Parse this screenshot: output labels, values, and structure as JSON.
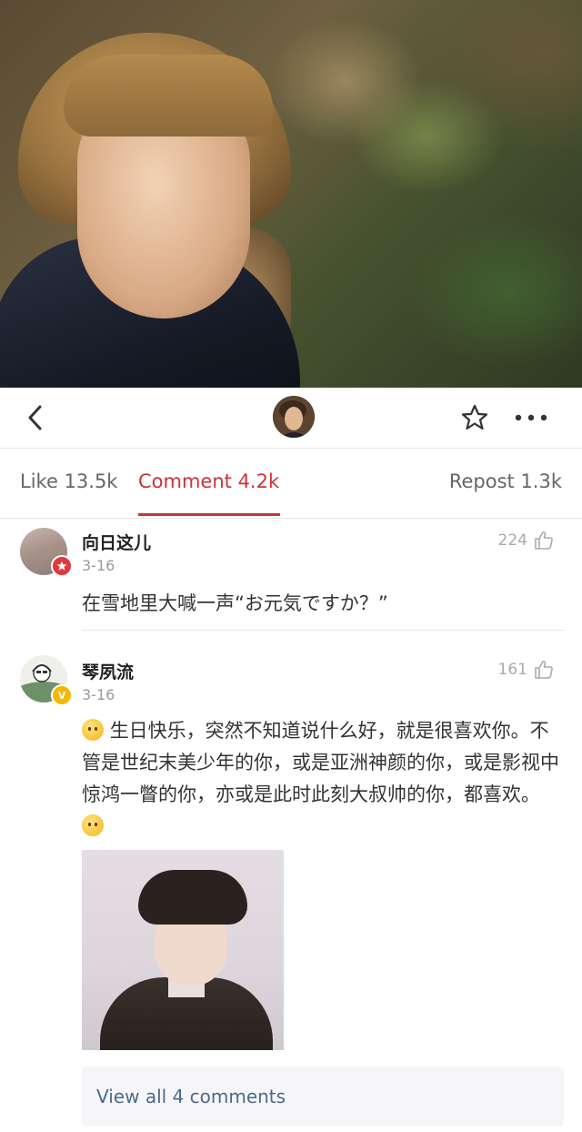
{
  "navbar": {
    "back_icon": "chevron-left-icon",
    "star_icon": "star-outline-icon",
    "more_icon": "more-dots-icon"
  },
  "tabs": {
    "like": "Like 13.5k",
    "comment": "Comment 4.2k",
    "repost": "Repost 1.3k",
    "active": "comment",
    "accent_color": "#c8343a"
  },
  "comments": [
    {
      "username": "向日这儿",
      "date": "3-16",
      "likes": "224",
      "badge": "red-star-badge",
      "text": "在雪地里大喊一声“お元気ですか？”"
    },
    {
      "username": "琴夙流",
      "date": "3-16",
      "likes": "161",
      "badge": "verified-v-badge",
      "badge_text": "V",
      "text_part1": "生日快乐，突然不知道说什么好，就是很喜欢你。不管是世纪末美少年的你，或是亚洲神颜的你，或是影视中惊鸿一瞥的你，亦或是此时此刻大叔帅的你，都喜欢。",
      "has_photo": true
    }
  ],
  "view_all": "View all 4 comments"
}
